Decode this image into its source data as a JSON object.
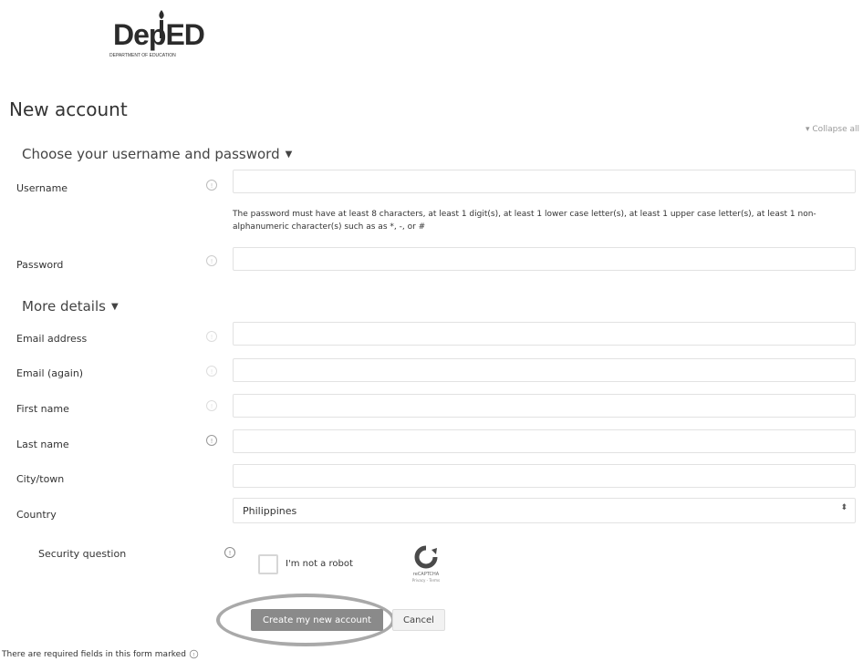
{
  "brand": {
    "logo_text": "DepED",
    "logo_sub": "DEPARTMENT OF EDUCATION"
  },
  "page": {
    "title": "New account",
    "collapse_all": "▾ Collapse all"
  },
  "sections": {
    "credentials": "Choose your username and password",
    "details": "More details"
  },
  "fields": {
    "username": {
      "label": "Username",
      "value": ""
    },
    "password": {
      "label": "Password",
      "value": "",
      "help": "The password must have at least 8 characters, at least 1 digit(s), at least 1 lower case letter(s), at least 1 upper case letter(s), at least 1 non-alphanumeric character(s) such as as *, -, or #"
    },
    "email": {
      "label": "Email address",
      "value": ""
    },
    "email_again": {
      "label": "Email (again)",
      "value": ""
    },
    "first_name": {
      "label": "First name",
      "value": ""
    },
    "last_name": {
      "label": "Last name",
      "value": ""
    },
    "city": {
      "label": "City/town",
      "value": ""
    },
    "country": {
      "label": "Country",
      "value": "Philippines"
    },
    "security": {
      "label": "Security question"
    }
  },
  "captcha": {
    "checkbox_label": "I'm not a robot",
    "brand": "reCAPTCHA",
    "links": "Privacy - Terms"
  },
  "actions": {
    "submit": "Create my new account",
    "cancel": "Cancel"
  },
  "footer": {
    "required_note": "There are required fields in this form marked"
  }
}
